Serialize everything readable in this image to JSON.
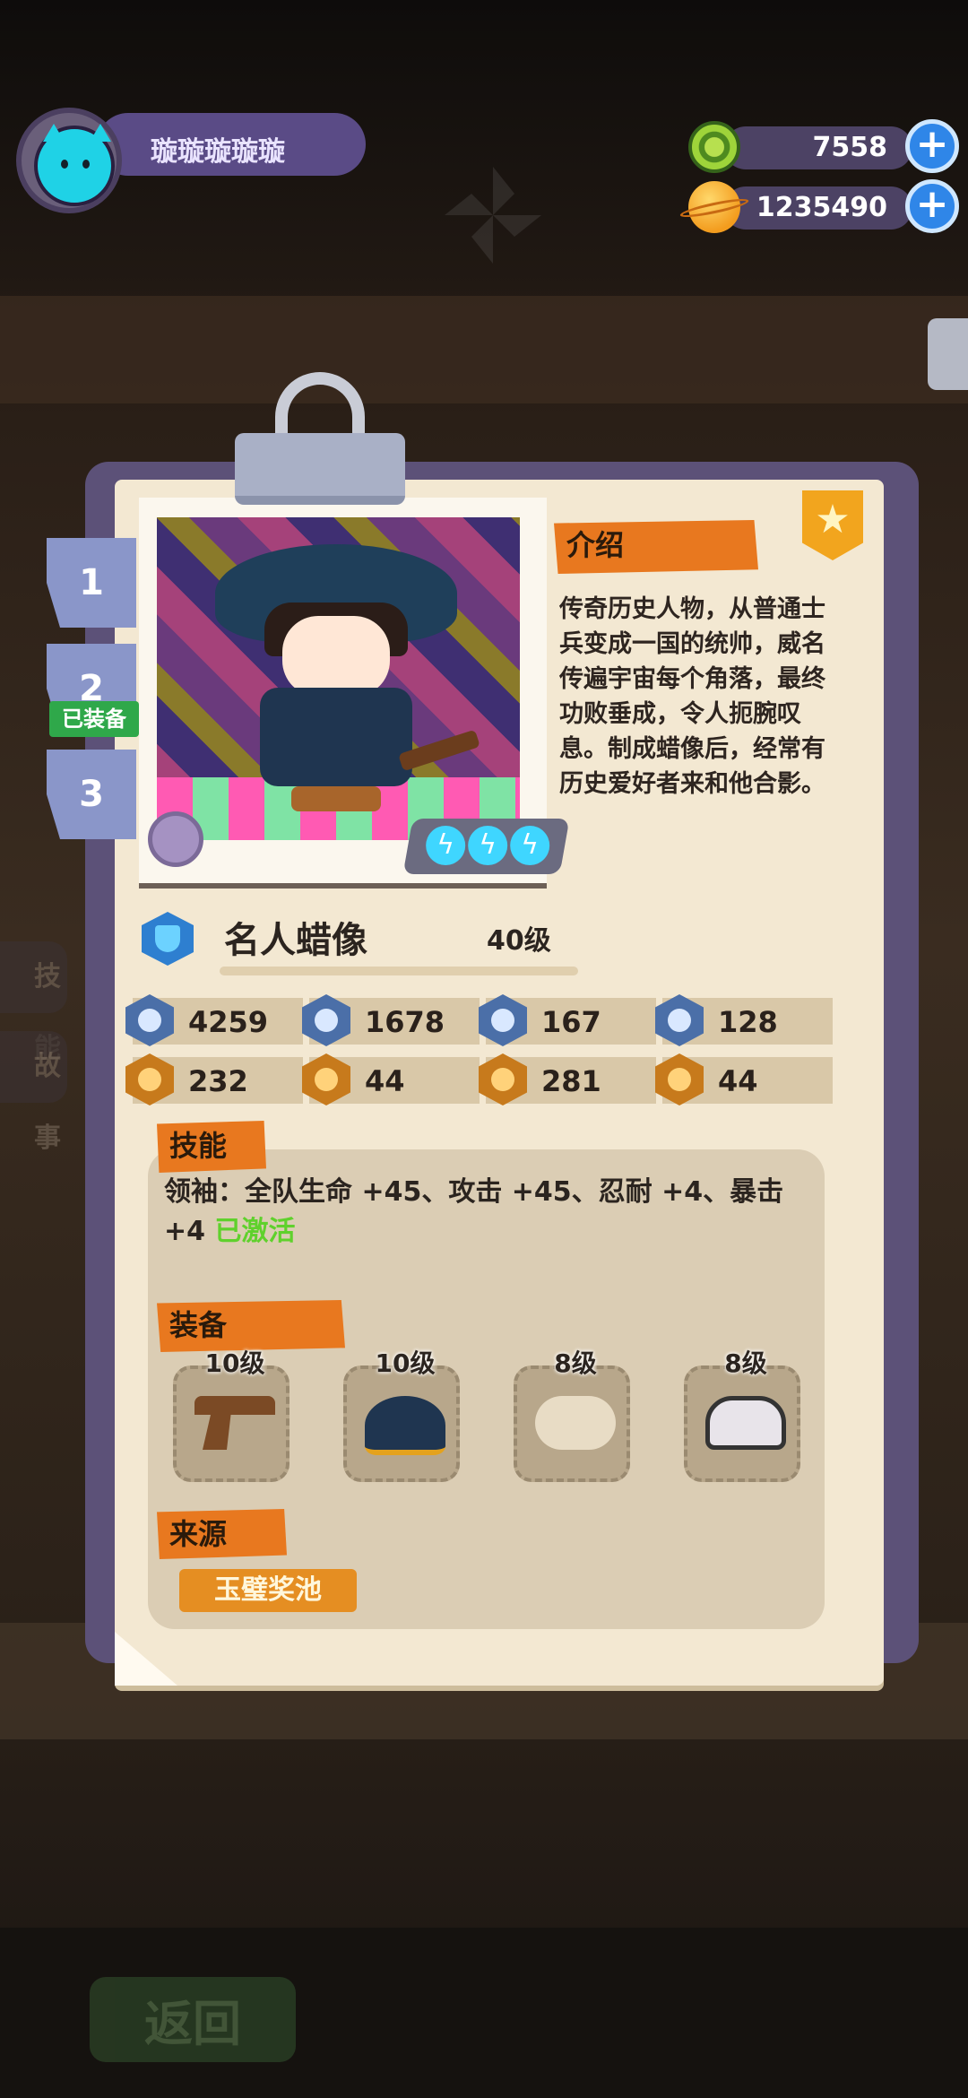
{
  "player": {
    "name": "璇璇璇璇璇"
  },
  "currencies": [
    {
      "icon": "green-gem-coin-icon",
      "value": "7558"
    },
    {
      "icon": "planet-coin-icon",
      "value": "1235490"
    }
  ],
  "outfit_tabs": [
    {
      "label": "1"
    },
    {
      "label": "2",
      "badge": "已装备"
    },
    {
      "label": "3"
    }
  ],
  "side_tabs": [
    "技能",
    "故事"
  ],
  "card": {
    "intro_title": "介绍",
    "intro_text": "传奇历史人物，从普通士兵变成一国的统帅，威名传遍宇宙每个角落，最终功败垂成，令人扼腕叹息。制成蜡像后，经常有历史爱好者来和他合影。",
    "name": "名人蜡像",
    "level": "40级",
    "energy_count": 3,
    "stats": [
      {
        "icon": "hp-heart-icon",
        "value": "4259",
        "style": "blue"
      },
      {
        "icon": "attack-sword-icon",
        "value": "1678",
        "style": "blue"
      },
      {
        "icon": "defense-shield-icon",
        "value": "167",
        "style": "blue"
      },
      {
        "icon": "anchor-icon",
        "value": "128",
        "style": "blue"
      },
      {
        "icon": "fist-icon",
        "value": "232",
        "style": "orange"
      },
      {
        "icon": "smile-icon",
        "value": "44",
        "style": "orange"
      },
      {
        "icon": "muscle-icon",
        "value": "281",
        "style": "orange"
      },
      {
        "icon": "brain-icon",
        "value": "44",
        "style": "orange"
      }
    ],
    "skills_title": "技能",
    "skill_text": "领袖：全队生命 +45、攻击 +45、忍耐 +4、暴击 +4",
    "skill_status": "已激活",
    "equip_title": "装备",
    "equipment": [
      {
        "level": "10级",
        "icon": "pistol-icon"
      },
      {
        "level": "10级",
        "icon": "bicorne-hat-icon"
      },
      {
        "level": "8级",
        "icon": "shoes-icon"
      },
      {
        "level": "8级",
        "icon": "penguin-badge-icon"
      }
    ],
    "source_title": "来源",
    "source_button": "玉璧奖池"
  },
  "footer": {
    "back_label": "返回"
  },
  "colors": {
    "accent_orange": "#e8781f",
    "panel_bg": "#f3e8d2",
    "frame_purple": "#5c5178",
    "active_green": "#5fd12c"
  }
}
